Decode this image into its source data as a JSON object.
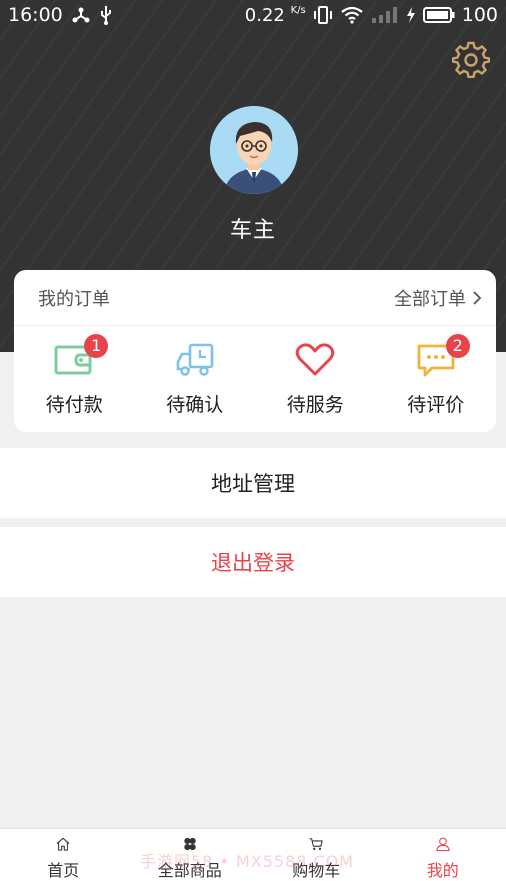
{
  "status_bar": {
    "time": "16:00",
    "net_speed": "0.22",
    "net_unit": "K/s",
    "battery": "100"
  },
  "header": {
    "user_name": "车主"
  },
  "orders": {
    "title": "我的订单",
    "all_label": "全部订单",
    "items": [
      {
        "label": "待付款",
        "icon": "wallet-icon",
        "badge": "1"
      },
      {
        "label": "待确认",
        "icon": "truck-icon",
        "badge": ""
      },
      {
        "label": "待服务",
        "icon": "heart-icon",
        "badge": ""
      },
      {
        "label": "待评价",
        "icon": "comment-icon",
        "badge": "2"
      }
    ]
  },
  "menu": {
    "address": "地址管理",
    "logout": "退出登录"
  },
  "tabbar": {
    "items": [
      {
        "label": "首页",
        "icon": "home-icon"
      },
      {
        "label": "全部商品",
        "icon": "grid-icon"
      },
      {
        "label": "购物车",
        "icon": "cart-icon"
      },
      {
        "label": "我的",
        "icon": "user-icon",
        "active": true
      }
    ]
  },
  "watermark": "手游网58 • MX5588.COM",
  "colors": {
    "accent": "#e8434a",
    "header_bg": "#333333",
    "page_bg": "#f0f0f0"
  }
}
